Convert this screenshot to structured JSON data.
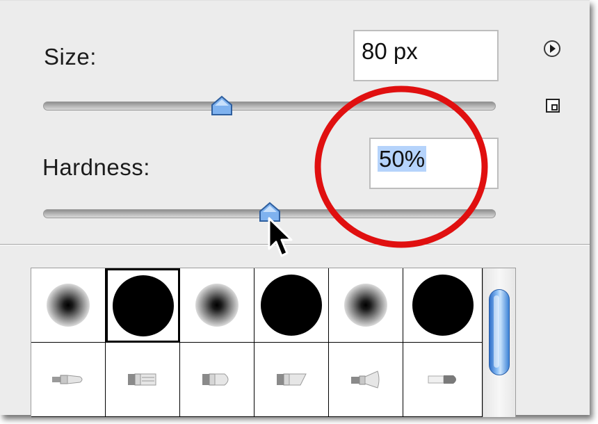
{
  "brush_options": {
    "size": {
      "label": "Size:",
      "value": "80 px",
      "slider_position": 0.4
    },
    "hardness": {
      "label": "Hardness:",
      "value": "50%",
      "slider_position": 0.5
    }
  },
  "presets": {
    "row1": [
      {
        "type": "soft",
        "icon": "soft-round-brush-icon"
      },
      {
        "type": "hard",
        "icon": "hard-round-brush-icon",
        "selected": true
      },
      {
        "type": "soft",
        "icon": "soft-round-brush-icon"
      },
      {
        "type": "hard",
        "icon": "hard-round-brush-icon"
      },
      {
        "type": "soft",
        "icon": "soft-round-brush-icon"
      },
      {
        "type": "hard",
        "icon": "hard-round-brush-icon"
      }
    ],
    "row2": [
      {
        "icon": "airbrush-tip-icon"
      },
      {
        "icon": "flat-brush-icon"
      },
      {
        "icon": "round-bristle-icon"
      },
      {
        "icon": "angled-bristle-icon"
      },
      {
        "icon": "fan-brush-icon"
      },
      {
        "icon": "blunt-round-brush-icon"
      }
    ]
  },
  "colors": {
    "panel_bg": "#ececec",
    "selection": "#b5d3fb",
    "annotation_red": "#e01010",
    "scroll_thumb": "#5a9be6"
  }
}
